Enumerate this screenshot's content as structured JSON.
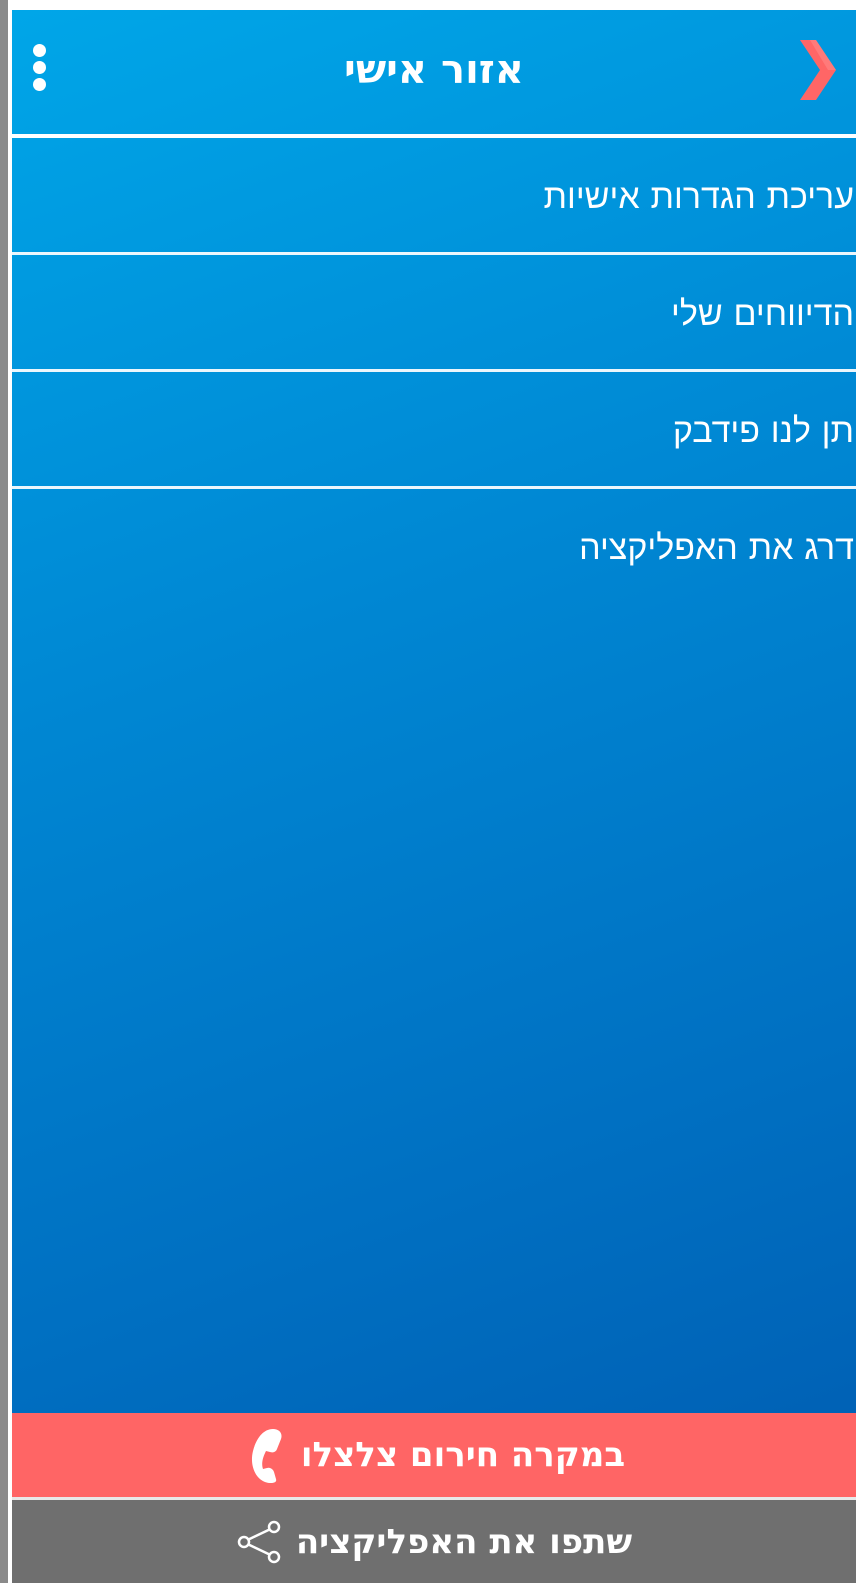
{
  "header": {
    "title": "אזור אישי",
    "menu_icon": "more-vertical-icon",
    "back_icon": "chevron-right-icon",
    "back_icon_color": "#ff6666"
  },
  "menu": {
    "items": [
      {
        "label": "עריכת הגדרות אישיות"
      },
      {
        "label": "הדיווחים שלי"
      },
      {
        "label": "תן לנו פידבק"
      },
      {
        "label": "דרג את האפליקציה"
      }
    ]
  },
  "footer": {
    "emergency": {
      "label": "במקרה חירום צלצלו",
      "icon": "phone-icon",
      "color": "#ff6565"
    },
    "share": {
      "label": "שתפו את האפליקציה",
      "icon": "share-icon",
      "color": "#6f6f6f"
    }
  },
  "theme": {
    "gradient_start": "#00a6e8",
    "gradient_end": "#005bb0"
  }
}
